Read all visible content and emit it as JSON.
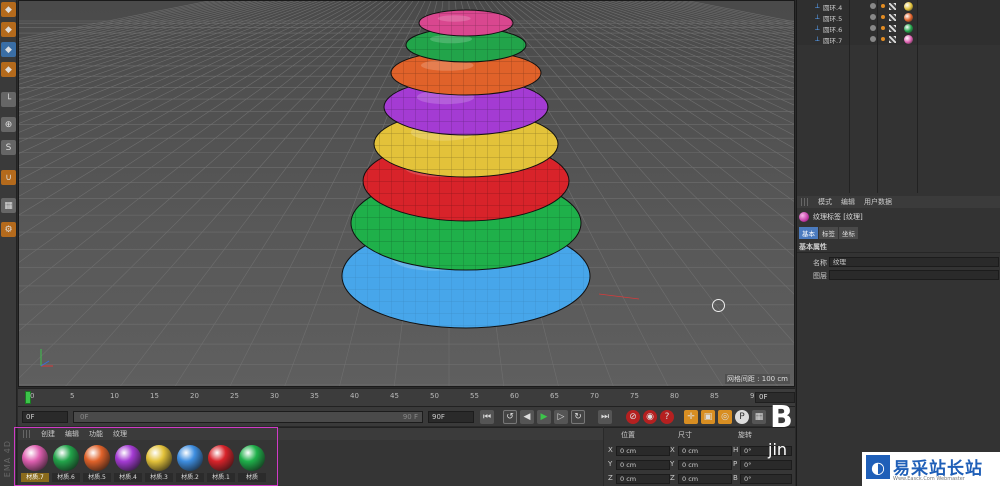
{
  "left_toolbar": {
    "buttons": [
      "cube-icon",
      "cube-icon",
      "cube-icon",
      "cube-icon",
      "axis-icon",
      "mouse-icon",
      "s-icon",
      "magnet-icon",
      "grid-icon",
      "gear-icon"
    ],
    "cinema_label": "EMA 4D"
  },
  "viewport": {
    "grid_readout": "网格间距 : 100 cm",
    "torus_colors": [
      "#47a6ea",
      "#1fb04a",
      "#d8232a",
      "#e3c23a",
      "#a43bd3",
      "#e0622a",
      "#22a44a",
      "#d9478f"
    ]
  },
  "timeline": {
    "ticks": [
      "0",
      "5",
      "10",
      "15",
      "20",
      "25",
      "30",
      "35",
      "40",
      "45",
      "50",
      "55",
      "60",
      "65",
      "70",
      "75",
      "80",
      "85",
      "90"
    ],
    "end_field": "0F"
  },
  "transport": {
    "start_field": "0F",
    "slider_left": "0F",
    "slider_right": "90 F",
    "field_a": "90 F",
    "field_b": "90F"
  },
  "materials": {
    "menu": [
      "创建",
      "编辑",
      "功能",
      "纹理"
    ],
    "items": [
      {
        "label": "材质.7",
        "color": "#de5fb0",
        "selected": true
      },
      {
        "label": "材质.6",
        "color": "#22a44a",
        "selected": false
      },
      {
        "label": "材质.5",
        "color": "#e0622a",
        "selected": false
      },
      {
        "label": "材质.4",
        "color": "#a43bd3",
        "selected": false
      },
      {
        "label": "材质.3",
        "color": "#e3c23a",
        "selected": false
      },
      {
        "label": "材质.2",
        "color": "#3e8ee0",
        "selected": false
      },
      {
        "label": "材质.1",
        "color": "#d8232a",
        "selected": false
      },
      {
        "label": "材质",
        "color": "#1fb04a",
        "selected": false
      }
    ]
  },
  "coords": {
    "headers": [
      "位置",
      "尺寸",
      "旋转"
    ],
    "rows": [
      {
        "axis": "X",
        "pos": "0 cm",
        "size": "0 cm",
        "rot_axis": "H",
        "rot": "0°"
      },
      {
        "axis": "Y",
        "pos": "0 cm",
        "size": "0 cm",
        "rot_axis": "P",
        "rot": "0°"
      },
      {
        "axis": "Z",
        "pos": "0 cm",
        "size": "0 cm",
        "rot_axis": "B",
        "rot": "0°"
      }
    ]
  },
  "objects": [
    {
      "name": "圆环.4",
      "swatch": "#e3c23a"
    },
    {
      "name": "圆环.5",
      "swatch": "#e0622a"
    },
    {
      "name": "圆环.6",
      "swatch": "#22a44a"
    },
    {
      "name": "圆环.7",
      "swatch": "#de5fb0"
    }
  ],
  "attributes": {
    "menu": [
      "模式",
      "编辑",
      "用户数据"
    ],
    "title": "纹理标签 [纹理]",
    "tabs": [
      "基本",
      "标签",
      "坐标"
    ],
    "section": "基本属性",
    "rows": [
      {
        "label": "名称",
        "value": "纹理"
      },
      {
        "label": "图层",
        "value": ""
      }
    ]
  },
  "watermark": {
    "b": "B",
    "jin": "jin",
    "logo_name": "易采站长站",
    "logo_url": "Www.Easck.Com Webmaster"
  }
}
